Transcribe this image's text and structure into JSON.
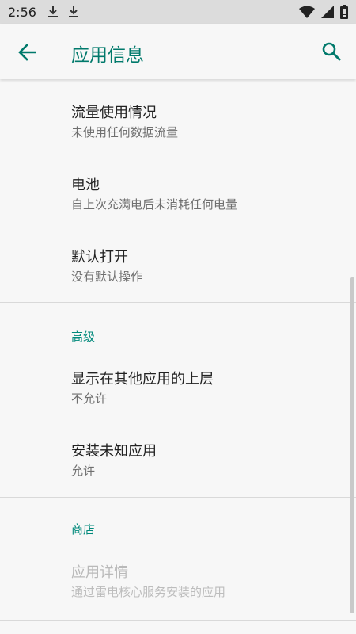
{
  "status_bar": {
    "time": "2:56"
  },
  "app_bar": {
    "title": "应用信息"
  },
  "items_top": [
    {
      "title": "流量使用情况",
      "subtitle": "未使用任何数据流量"
    },
    {
      "title": "电池",
      "subtitle": "自上次充满电后未消耗任何电量"
    },
    {
      "title": "默认打开",
      "subtitle": "没有默认操作"
    }
  ],
  "section_advanced": {
    "header": "高级",
    "items": [
      {
        "title": "显示在其他应用的上层",
        "subtitle": "不允许"
      },
      {
        "title": "安装未知应用",
        "subtitle": "允许"
      }
    ]
  },
  "section_store": {
    "header": "商店",
    "items": [
      {
        "title": "应用详情",
        "subtitle": "通过雷电核心服务安装的应用"
      }
    ]
  },
  "colors": {
    "accent": "#00796b",
    "status_bar_bg": "#dcdcdc",
    "background": "#f7f7f7"
  },
  "icons": [
    "download-icon",
    "download-icon",
    "wifi-icon",
    "signal-icon",
    "battery-icon",
    "back-arrow-icon",
    "search-icon"
  ]
}
